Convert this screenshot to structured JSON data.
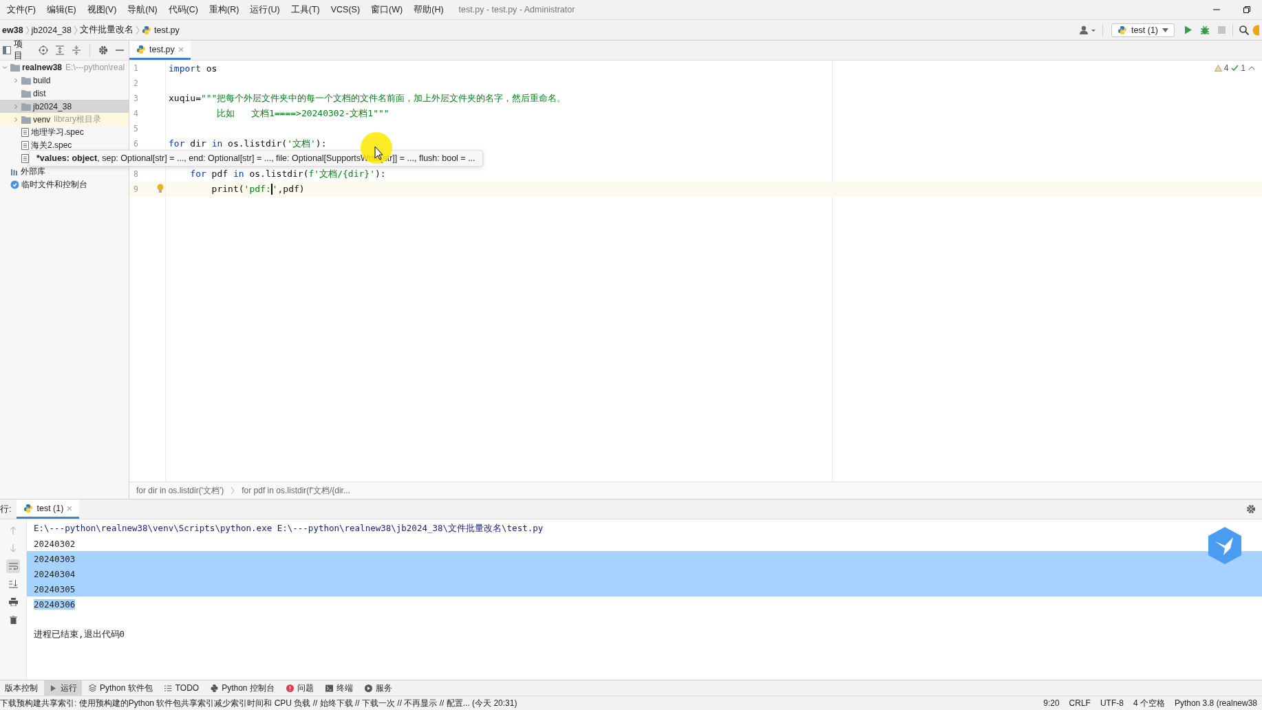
{
  "window": {
    "title": "test.py - test.py - Administrator"
  },
  "menu": [
    "文件(F)",
    "编辑(E)",
    "视图(V)",
    "导航(N)",
    "代码(C)",
    "重构(R)",
    "运行(U)",
    "工具(T)",
    "VCS(S)",
    "窗口(W)",
    "帮助(H)"
  ],
  "breadcrumbs": [
    "ew38",
    "jb2024_38",
    "文件批量改名",
    "test.py"
  ],
  "toolbar": {
    "run_config": "test (1)"
  },
  "project_panel": {
    "title": "项目",
    "tree": [
      {
        "label": "realnew38",
        "hint": "E:\\---python\\real",
        "kind": "root",
        "expanded": true,
        "selected": false,
        "children": [
          {
            "label": "build",
            "kind": "folder",
            "expanded": false,
            "selected": false
          },
          {
            "label": "dist",
            "kind": "folder",
            "selected": false
          },
          {
            "label": "jb2024_38",
            "kind": "folder",
            "expanded": false,
            "selected": true
          },
          {
            "label": "venv",
            "hint": "library根目录",
            "kind": "folder",
            "expanded": false,
            "selected": false
          },
          {
            "label": "地理学习.spec",
            "kind": "file",
            "selected": false
          },
          {
            "label": "海关2.spec",
            "kind": "file",
            "selected": false
          },
          {
            "kind": "file",
            "selected": false
          }
        ]
      },
      {
        "label": "外部库",
        "kind": "library",
        "selected": false
      },
      {
        "label": "临时文件和控制台",
        "kind": "scratch",
        "selected": false
      }
    ]
  },
  "editor": {
    "tabs": [
      {
        "label": "test.py",
        "selected": true
      }
    ],
    "inspections": {
      "warnings": "4",
      "typos": "1"
    },
    "lines": [
      {
        "number": "1",
        "segments": [
          {
            "text": "import",
            "kind": "keyword"
          },
          {
            "text": " os",
            "kind": "plain"
          }
        ]
      },
      {
        "number": "2"
      },
      {
        "number": "3",
        "segments": [
          {
            "text": "xuqiu=",
            "kind": "plain"
          },
          {
            "text": "\"\"\"把每个外层文件夹中的每一个文档的文件名前面，加上外层文件夹的名字，然后重命名。",
            "kind": "string"
          }
        ]
      },
      {
        "number": "4",
        "segments": [
          {
            "text": "         比如   文档1====>20240302-文档1\"\"\"",
            "kind": "string"
          }
        ]
      },
      {
        "number": "5"
      },
      {
        "number": "6",
        "segments": [
          {
            "text": "for",
            "kind": "keyword"
          },
          {
            "text": " dir ",
            "kind": "plain"
          },
          {
            "text": "in",
            "kind": "keyword"
          },
          {
            "text": " os.listdir(",
            "kind": "plain"
          },
          {
            "text": "'文档'",
            "kind": "string"
          },
          {
            "text": "):",
            "kind": "plain"
          }
        ]
      },
      {
        "number": "8",
        "segments": [
          {
            "text": "    for",
            "kind": "keyword"
          },
          {
            "text": " pdf ",
            "kind": "plain"
          },
          {
            "text": "in",
            "kind": "keyword"
          },
          {
            "text": " os.listdir(",
            "kind": "plain"
          },
          {
            "text": "f'文档/{dir}'",
            "kind": "string"
          },
          {
            "text": "):",
            "kind": "plain"
          }
        ]
      },
      {
        "number": "9",
        "current": true,
        "bulb": true,
        "segments": [
          {
            "text": "        print(",
            "kind": "plain"
          },
          {
            "text": "'pdf:",
            "kind": "string",
            "caret_after": true
          },
          {
            "text": "'",
            "kind": "string"
          },
          {
            "text": ",pdf)",
            "kind": "plain"
          }
        ]
      }
    ],
    "tooltip": {
      "signature_bold": "*values: object",
      "signature_rest": ", sep: Optional[str] = ..., end: Optional[str] = ..., file: Optional[SupportsWrite[str]] = ..., flush: bool = ..."
    },
    "footer_breadcrumbs": [
      "for dir in os.listdir('文档')",
      "for pdf in os.listdir(f'文档/{dir..."
    ]
  },
  "run_panel": {
    "label": "行:",
    "tabs": [
      {
        "label": "test (1)",
        "selected": true
      }
    ],
    "output": [
      {
        "text": "E:\\---python\\realnew38\\venv\\Scripts\\python.exe E:\\---python\\realnew38\\jb2024_38\\文件批量改名\\test.py",
        "kind": "command",
        "selected": false
      },
      {
        "text": "20240302",
        "kind": "output",
        "selected": false
      },
      {
        "text": "20240303",
        "kind": "output",
        "selected": true
      },
      {
        "text": "20240304",
        "kind": "output",
        "selected": true
      },
      {
        "text": "20240305",
        "kind": "output",
        "selected": true
      },
      {
        "text": "20240306",
        "kind": "output",
        "selected": true
      },
      {
        "kind": "blank",
        "selected": false
      },
      {
        "text": "进程已结束,退出代码0",
        "kind": "output",
        "selected": false
      }
    ]
  },
  "tool_windows": [
    {
      "label": "版本控制",
      "kind": "vcs",
      "selected": false
    },
    {
      "label": "运行",
      "kind": "run",
      "selected": true
    },
    {
      "label": "Python 软件包",
      "kind": "packages",
      "selected": false
    },
    {
      "label": "TODO",
      "kind": "todo",
      "selected": false
    },
    {
      "label": "Python 控制台",
      "kind": "console",
      "selected": false
    },
    {
      "label": "问题",
      "kind": "problems",
      "selected": false
    },
    {
      "label": "终端",
      "kind": "terminal",
      "selected": false
    },
    {
      "label": "服务",
      "kind": "services",
      "selected": false
    }
  ],
  "status_bar": {
    "message": "下载预构建共享索引: 使用预构建的Python 软件包共享索引减少索引时间和 CPU 负载 // 始终下载 // 下载一次 // 不再显示 // 配置... (今天 20:31)",
    "items": [
      "9:20",
      "CRLF",
      "UTF-8",
      "4 个空格",
      "Python 3.8 (realnew38"
    ]
  }
}
